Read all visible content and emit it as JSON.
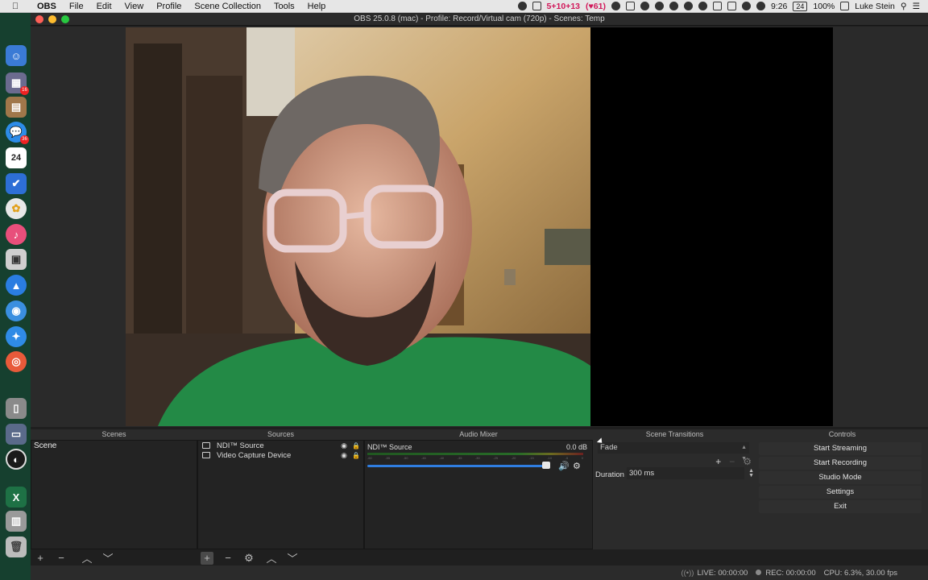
{
  "menubar": {
    "app": "OBS",
    "items": [
      "File",
      "Edit",
      "View",
      "Profile",
      "Scene Collection",
      "Tools",
      "Help"
    ],
    "messages": "5+10+13",
    "hearts": "61",
    "display_num": "24",
    "time": "9:26",
    "battery": "100%",
    "user": "Luke Stein"
  },
  "window": {
    "title": "OBS 25.0.8 (mac) - Profile: Record/Virtual cam (720p) - Scenes: Temp"
  },
  "dock": {
    "calendar_date": "24",
    "badges": [
      "16",
      "36"
    ]
  },
  "docks": {
    "scenes_title": "Scenes",
    "sources_title": "Sources",
    "mixer_title": "Audio Mixer",
    "transitions_title": "Scene Transitions",
    "controls_title": "Controls"
  },
  "scenes": [
    "Scene"
  ],
  "sources": [
    {
      "name": "NDI™ Source"
    },
    {
      "name": "Video Capture Device"
    }
  ],
  "mixer": {
    "channel": "NDI™ Source",
    "level": "0.0 dB",
    "ticks": [
      "-60",
      "-55",
      "-50",
      "-45",
      "-40",
      "-35",
      "-30",
      "-25",
      "-20",
      "-15",
      "-10",
      "-5",
      "0"
    ],
    "volume_fraction": 0.83
  },
  "transitions": {
    "selected": "Fade",
    "duration_label": "Duration",
    "duration_value": "300 ms"
  },
  "controls": {
    "start_streaming": "Start Streaming",
    "start_recording": "Start Recording",
    "studio_mode": "Studio Mode",
    "settings": "Settings",
    "exit": "Exit"
  },
  "status": {
    "live": "LIVE: 00:00:00",
    "rec": "REC: 00:00:00",
    "cpu": "CPU: 6.3%, 30.00 fps"
  },
  "colors": {
    "accent_blue": "#2f7de0",
    "dock_bg": "#16402f",
    "panel_bg": "#232323"
  }
}
